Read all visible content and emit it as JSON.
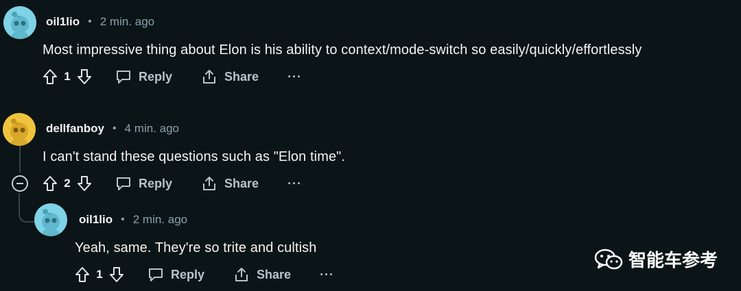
{
  "colors": {
    "background": "#0b1416",
    "avatar_teal": "#7fd3e6",
    "avatar_yellow": "#f0c33c",
    "muted_text": "#8ba2ad",
    "action_text": "#b7c4cb"
  },
  "comments": [
    {
      "username": "oil1lio",
      "separator": "•",
      "time": "2 min. ago",
      "body": "Most impressive thing about Elon is his ability to context/mode-switch so easily/quickly/effortlessly",
      "votes": "1",
      "reply_label": "Reply",
      "share_label": "Share",
      "more_label": "···",
      "avatar_icon": "snoo-avatar-icon"
    },
    {
      "username": "dellfanboy",
      "separator": "•",
      "time": "4 min. ago",
      "body": "I can't stand these questions such as \"Elon time\".",
      "votes": "2",
      "reply_label": "Reply",
      "share_label": "Share",
      "more_label": "···",
      "avatar_icon": "snoo-avatar-icon"
    },
    {
      "username": "oil1lio",
      "separator": "•",
      "time": "2 min. ago",
      "body": "Yeah, same. They're so trite and cultish",
      "votes": "1",
      "reply_label": "Reply",
      "share_label": "Share",
      "more_label": "···",
      "avatar_icon": "snoo-avatar-icon"
    }
  ],
  "watermark": {
    "text": "智能车参考",
    "icon": "wechat-icon"
  }
}
